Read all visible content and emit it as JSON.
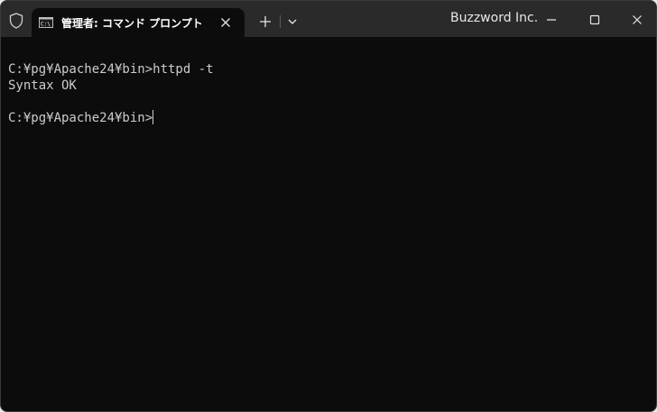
{
  "titlebar": {
    "tab_title": "管理者: コマンド プロンプト",
    "watermark": "Buzzword Inc.",
    "icons": {
      "shield": "shield-icon",
      "tab": "command-prompt-icon",
      "close_tab": "close-icon",
      "new_tab": "plus-icon",
      "dropdown": "chevron-down-icon",
      "minimize": "minimize-icon",
      "maximize": "maximize-icon",
      "close_window": "close-icon"
    }
  },
  "terminal": {
    "lines": [
      "C:¥pg¥Apache24¥bin>httpd -t",
      "Syntax OK",
      "",
      "C:¥pg¥Apache24¥bin>"
    ]
  },
  "colors": {
    "titlebar_bg": "#2a2a2a",
    "terminal_bg": "#0c0c0c",
    "text": "#cccccc"
  }
}
